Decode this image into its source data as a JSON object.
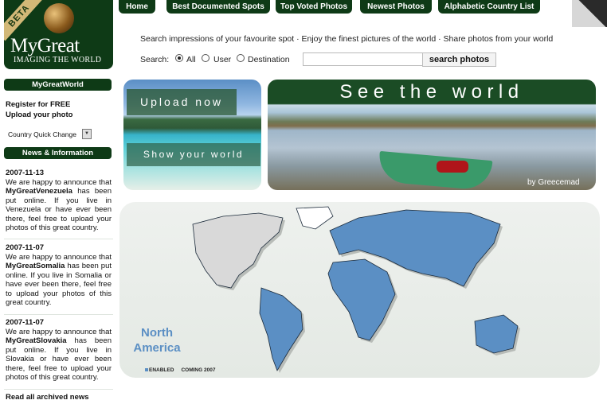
{
  "logo": {
    "badge": "BETA",
    "brand": "MyGreat",
    "tagline": "IMAGING THE WORLD"
  },
  "nav": [
    {
      "label": "Home"
    },
    {
      "label": "Best Documented Spots"
    },
    {
      "label": "Top Voted Photos"
    },
    {
      "label": "Newest Photos"
    },
    {
      "label": "Alphabetic Country List"
    }
  ],
  "search": {
    "tagline": "Search impressions of your favourite spot · Enjoy the finest pictures of the world · Share photos from your world",
    "label": "Search:",
    "options": [
      {
        "label": "All",
        "selected": true
      },
      {
        "label": "User",
        "selected": false
      },
      {
        "label": "Destination",
        "selected": false
      }
    ],
    "input_value": "",
    "button_label": "search photos"
  },
  "sidebar": {
    "section_title": "MyGreatWorld",
    "register_label": "Register for FREE",
    "upload_label": "Upload your photo",
    "country_quick_change": "Country Quick Change",
    "news_title": "News & Information",
    "news": [
      {
        "date": "2007-11-13",
        "pre": "We are happy to announce that ",
        "highlight": "MyGreatVenezuela",
        "post": " has been put online. If you live in Venezuela or have ever been there, feel free to upload your photos of this great country."
      },
      {
        "date": "2007-11-07",
        "pre": "We are happy to announce that ",
        "highlight": "MyGreatSomalia",
        "post": " has been put online. If you live in Somalia or have ever been there, feel free to upload your photos of this great country."
      },
      {
        "date": "2007-11-07",
        "pre": "We are happy to announce that ",
        "highlight": "MyGreatSlovakia",
        "post": " has been put online. If you live in Slovakia or have ever been there, feel free to upload your photos of this great country."
      }
    ],
    "archive_link": "Read all archived news"
  },
  "banners": {
    "upload_label": "Upload now",
    "show_label": "Show your world",
    "see_title": "See the world",
    "credit": "by Greecemad"
  },
  "map": {
    "region_label_line1": "North",
    "region_label_line2": "America",
    "legend_enabled": "ENABLED",
    "legend_coming": "COMING 2007",
    "colors": {
      "enabled": "#5b8fc4",
      "coming": "#d9d9d9",
      "ocean": "#e9ede9",
      "shadow": "#b8bcb8"
    }
  },
  "colors": {
    "brand_green": "#0e3a16",
    "accent_blue": "#5b8fc4"
  }
}
